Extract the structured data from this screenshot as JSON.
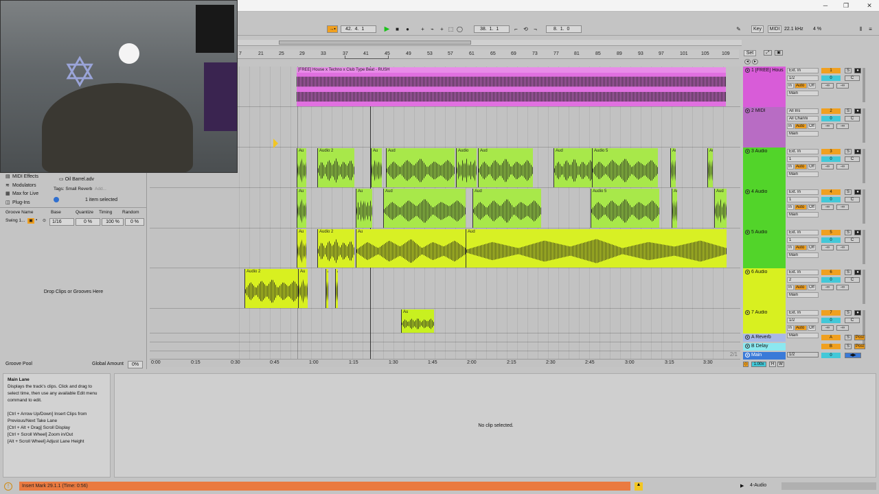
{
  "window": {
    "min": "─",
    "max": "❐",
    "close": "✕"
  },
  "transport": {
    "pos_bars": "42",
    "pos_beats": "4",
    "pos_sixteenths": "1",
    "loop_start_bars": "38",
    "loop_start_beats": "1",
    "loop_start_six": "1",
    "loop_len_bars": "8",
    "loop_len_beats": "1",
    "loop_len_six": "0",
    "key_label": "Key",
    "midi_label": "MIDI",
    "sample_rate": "22.1 kHz",
    "cpu": "4 %"
  },
  "ruler": {
    "bars": [
      "7",
      "21",
      "25",
      "29",
      "33",
      "37",
      "41",
      "45",
      "49",
      "53",
      "57",
      "61",
      "65",
      "69",
      "73",
      "77",
      "81",
      "85",
      "89",
      "93",
      "97",
      "101",
      "105",
      "109"
    ],
    "set_label": "Set"
  },
  "time_ruler": {
    "ticks": [
      "0:00",
      "0:15",
      "0:30",
      "0:45",
      "1:00",
      "1:15",
      "1:30",
      "1:45",
      "2:00",
      "2:15",
      "2:30",
      "2:45",
      "3:00",
      "3:15",
      "3:30"
    ],
    "grid": "2/1"
  },
  "browser": {
    "items": [
      "MIDI Effects",
      "Modulators",
      "Max for Live",
      "Plug-Ins"
    ],
    "file": "Oil Barrel.adv",
    "tags_label": "Tags:",
    "tag": "Small Reverb",
    "add": "Add...",
    "selected": "1 item selected"
  },
  "groove": {
    "cols": [
      "Groove Name",
      "Base",
      "Quantize",
      "Timing",
      "Random"
    ],
    "row": {
      "name": "Swing 1...",
      "base": "1/16",
      "quantize": "0 %",
      "timing": "100 %",
      "random": "0 %"
    },
    "drop_text": "Drop Clips or Grooves Here",
    "pool_label": "Groove Pool",
    "global_label": "Global Amount",
    "global_val": "0%"
  },
  "tracks": [
    {
      "num": "1",
      "name": "1 [FREE] Hous",
      "input": "Ext. In",
      "chan": "1/2",
      "route": "Main",
      "vol": "0",
      "pan": "C",
      "color": "#d85cd8"
    },
    {
      "num": "2",
      "name": "2 MIDI",
      "input": "All Ins",
      "chan": "All Channi",
      "route": "Main",
      "vol": "0",
      "pan": "C",
      "color": "#b86cc4"
    },
    {
      "num": "3",
      "name": "3 Audio",
      "input": "Ext. In",
      "chan": "1",
      "route": "Main",
      "vol": "0",
      "pan": "C",
      "color": "#52d42a"
    },
    {
      "num": "4",
      "name": "4 Audio",
      "input": "Ext. In",
      "chan": "1",
      "route": "Main",
      "vol": "0",
      "pan": "C",
      "color": "#52d42a"
    },
    {
      "num": "5",
      "name": "5 Audio",
      "input": "Ext. In",
      "chan": "1",
      "route": "Main",
      "vol": "0",
      "pan": "C",
      "color": "#52d42a"
    },
    {
      "num": "6",
      "name": "6 Audio",
      "input": "Ext. In",
      "chan": "2",
      "route": "Main",
      "vol": "0",
      "pan": "C",
      "color": "#d8f020"
    },
    {
      "num": "7",
      "name": "7 Audio",
      "input": "Ext. In",
      "chan": "1/2",
      "route": "Main",
      "vol": "0",
      "pan": "C",
      "color": "#d8f020"
    }
  ],
  "returns": [
    {
      "name": "A Reverb",
      "letter": "A",
      "post": "Post"
    },
    {
      "name": "B Delay",
      "letter": "B",
      "post": "Post"
    }
  ],
  "main": {
    "name": "Main",
    "chan": "1/2",
    "vol": "0"
  },
  "track_labels": {
    "in": "In",
    "auto": "Auto",
    "off": "Off",
    "solo": "S",
    "inf": "-∞"
  },
  "clips": {
    "track1": "[FREE] House x Techno x Club Type Beat - RUSH",
    "audio": "Audio",
    "audio2": "Audio 2",
    "audio5": "Audio 5",
    "aud": "Aud",
    "au": "Au"
  },
  "zoom": "1.00x",
  "hw": "H",
  "w": "W",
  "info_panel": {
    "title": "Main Lane",
    "lines": [
      "Displays the track's clips. Click and drag to",
      "select time, then use any available Edit menu",
      "command to edit.",
      "",
      "[Ctrl + Arrow Up/Down] Insert Clips from",
      "Previous/Next Take Lane",
      "[Ctrl + Alt + Drag] Scroll Display",
      "[Ctrl + Scroll Wheel] Zoom in/Out",
      "[Alt + Scroll Wheel] Adjust Lane Height"
    ]
  },
  "clip_view": {
    "empty": "No clip selected."
  },
  "status": {
    "message": "Insert Mark 29.1.1 (Time: 0:56)",
    "track": "4-Audio"
  }
}
